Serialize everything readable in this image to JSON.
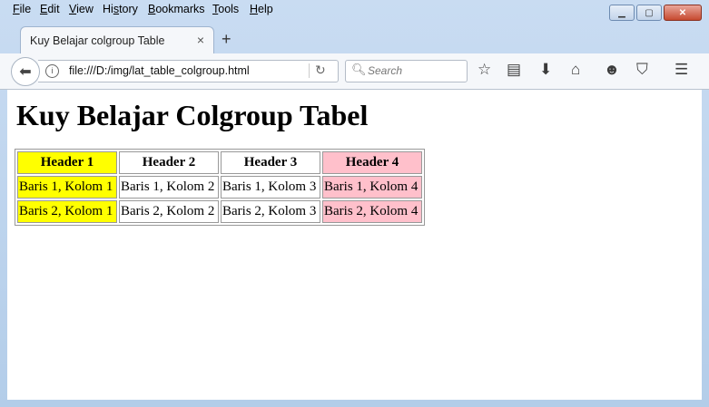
{
  "menubar": {
    "items": [
      {
        "label_u": "F",
        "label_rest": "ile"
      },
      {
        "label_u": "E",
        "label_rest": "dit"
      },
      {
        "label_u": "V",
        "label_rest": "iew"
      },
      {
        "label_pre": "Hi",
        "label_u": "s",
        "label_rest": "tory"
      },
      {
        "label_u": "B",
        "label_rest": "ookmarks"
      },
      {
        "label_u": "T",
        "label_rest": "ools"
      },
      {
        "label_u": "H",
        "label_rest": "elp"
      }
    ]
  },
  "tab": {
    "title": "Kuy Belajar colgroup Table",
    "close": "×"
  },
  "new_tab": "+",
  "address": {
    "url": "file:///D:/img/lat_table_colgroup.html"
  },
  "search": {
    "placeholder": "Search"
  },
  "page": {
    "heading": "Kuy Belajar Colgroup Tabel",
    "table": {
      "headers": [
        "Header 1",
        "Header 2",
        "Header 3",
        "Header 4"
      ],
      "rows": [
        [
          "Baris 1, Kolom 1",
          "Baris 1, Kolom 2",
          "Baris 1, Kolom 3",
          "Baris 1, Kolom 4"
        ],
        [
          "Baris 2, Kolom 1",
          "Baris 2, Kolom 2",
          "Baris 2, Kolom 3",
          "Baris 2, Kolom 4"
        ]
      ],
      "col_colors": [
        "#ffff00",
        "",
        "",
        "#ffc0cb"
      ]
    }
  },
  "icons": {
    "minimize": "minimize-icon",
    "maximize": "maximize-icon",
    "close": "close-icon",
    "back": "back-arrow-icon",
    "info": "info-icon",
    "reload": "reload-icon",
    "search": "search-icon",
    "bookmark": "star-icon",
    "reader": "clipboard-icon",
    "download": "download-icon",
    "home": "home-icon",
    "hello": "smiley-icon",
    "pocket": "pocket-icon",
    "menu": "hamburger-menu-icon"
  }
}
